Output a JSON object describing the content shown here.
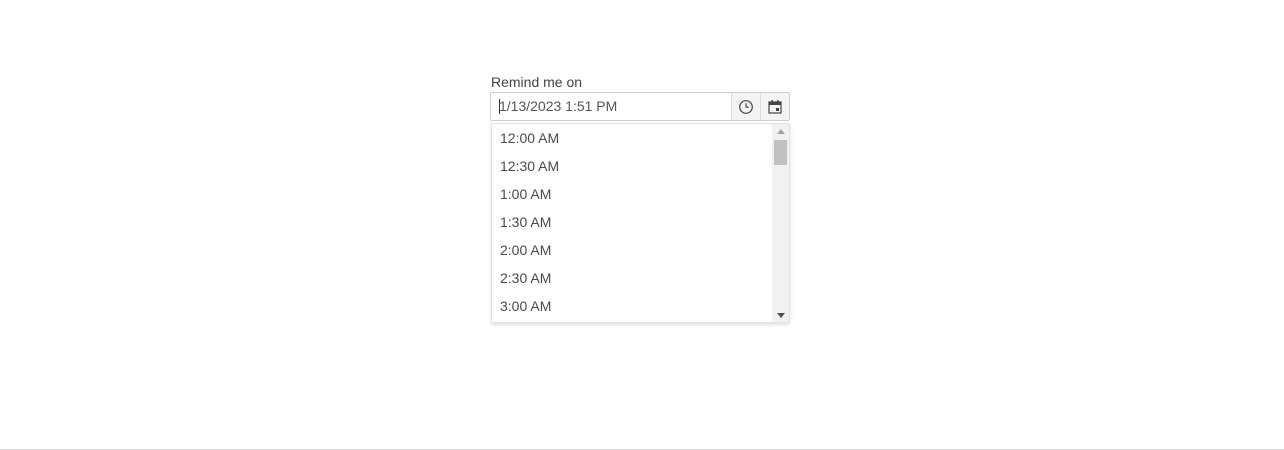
{
  "reminder": {
    "label": "Remind me on",
    "value": "1/13/2023 1:51 PM",
    "buttons": {
      "time_icon": "clock-icon",
      "date_icon": "calendar-icon"
    }
  },
  "time_popup": {
    "options": [
      "12:00 AM",
      "12:30 AM",
      "1:00 AM",
      "1:30 AM",
      "2:00 AM",
      "2:30 AM",
      "3:00 AM"
    ],
    "scroll_position": 0
  },
  "colors": {
    "text": "#4a4a4a",
    "border": "#cfcfcf",
    "button_bg": "#f3f3f3",
    "scroll_thumb": "#c1c1c1"
  }
}
